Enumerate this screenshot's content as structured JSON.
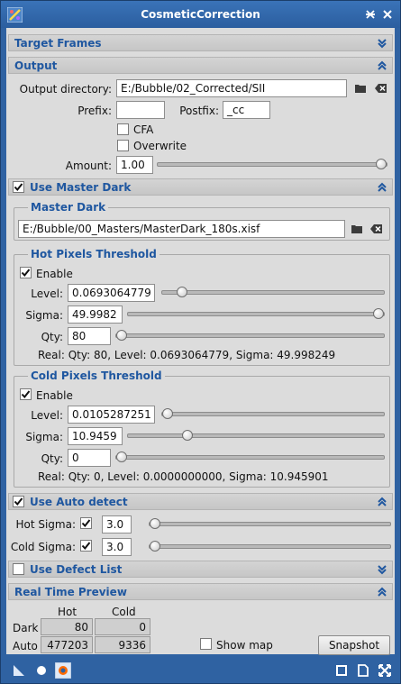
{
  "window": {
    "title": "CosmeticCorrection"
  },
  "sections": {
    "target_frames": "Target Frames",
    "output": "Output",
    "use_master_dark": "Use Master Dark",
    "use_auto_detect": "Use Auto detect",
    "use_defect_list": "Use Defect List",
    "real_time_preview": "Real Time Preview"
  },
  "output": {
    "dir_label": "Output directory:",
    "dir_value": "E:/Bubble/02_Corrected/SII",
    "prefix_label": "Prefix:",
    "prefix_value": "",
    "postfix_label": "Postfix:",
    "postfix_value": "_cc",
    "cfa_label": "CFA",
    "cfa_checked": false,
    "overwrite_label": "Overwrite",
    "overwrite_checked": false,
    "amount_label": "Amount:",
    "amount_value": "1.00",
    "amount_fraction": 1.0
  },
  "master_dark": {
    "enabled": true,
    "group_title": "Master Dark",
    "path": "E:/Bubble/00_Masters/MasterDark_180s.xisf",
    "hot": {
      "title": "Hot Pixels Threshold",
      "enable_label": "Enable",
      "enabled": true,
      "level_label": "Level:",
      "level_value": "0.0693064779",
      "level_fraction": 0.07,
      "sigma_label": "Sigma:",
      "sigma_value": "49.9982",
      "sigma_fraction": 1.0,
      "qty_label": "Qty:",
      "qty_value": "80",
      "qty_fraction": 0.0,
      "real_text": "Real: Qty: 80, Level: 0.0693064779, Sigma: 49.998249"
    },
    "cold": {
      "title": "Cold Pixels Threshold",
      "enable_label": "Enable",
      "enabled": true,
      "level_label": "Level:",
      "level_value": "0.0105287251",
      "level_fraction": 0.0,
      "sigma_label": "Sigma:",
      "sigma_value": "10.9459",
      "sigma_fraction": 0.22,
      "qty_label": "Qty:",
      "qty_value": "0",
      "qty_fraction": 0.0,
      "real_text": "Real: Qty: 0, Level: 0.0000000000, Sigma: 10.945901"
    }
  },
  "auto_detect": {
    "enabled": true,
    "hot_label": "Hot Sigma:",
    "hot_checked": true,
    "hot_value": "3.0",
    "hot_fraction": 0.0,
    "cold_label": "Cold Sigma:",
    "cold_checked": true,
    "cold_value": "3.0",
    "cold_fraction": 0.0
  },
  "defect_list": {
    "enabled": false
  },
  "preview": {
    "col_hot": "Hot",
    "col_cold": "Cold",
    "row_dark": "Dark",
    "row_auto": "Auto",
    "dark_hot": "80",
    "dark_cold": "0",
    "auto_hot": "477203",
    "auto_cold": "9336",
    "show_map_label": "Show map",
    "show_map_checked": false,
    "snapshot_label": "Snapshot"
  },
  "colors": {
    "accent": "#1f57a0",
    "window": "#2f62a2",
    "panel": "#dcdcdc"
  },
  "icons": {
    "title_left": "app-icon",
    "title_right": [
      "pin-icon",
      "close-icon"
    ],
    "bottom_left": [
      "new-instance-icon",
      "apply-global-icon",
      "reset-icon"
    ],
    "bottom_right": [
      "preview-icon",
      "document-icon",
      "expand-icon"
    ]
  }
}
